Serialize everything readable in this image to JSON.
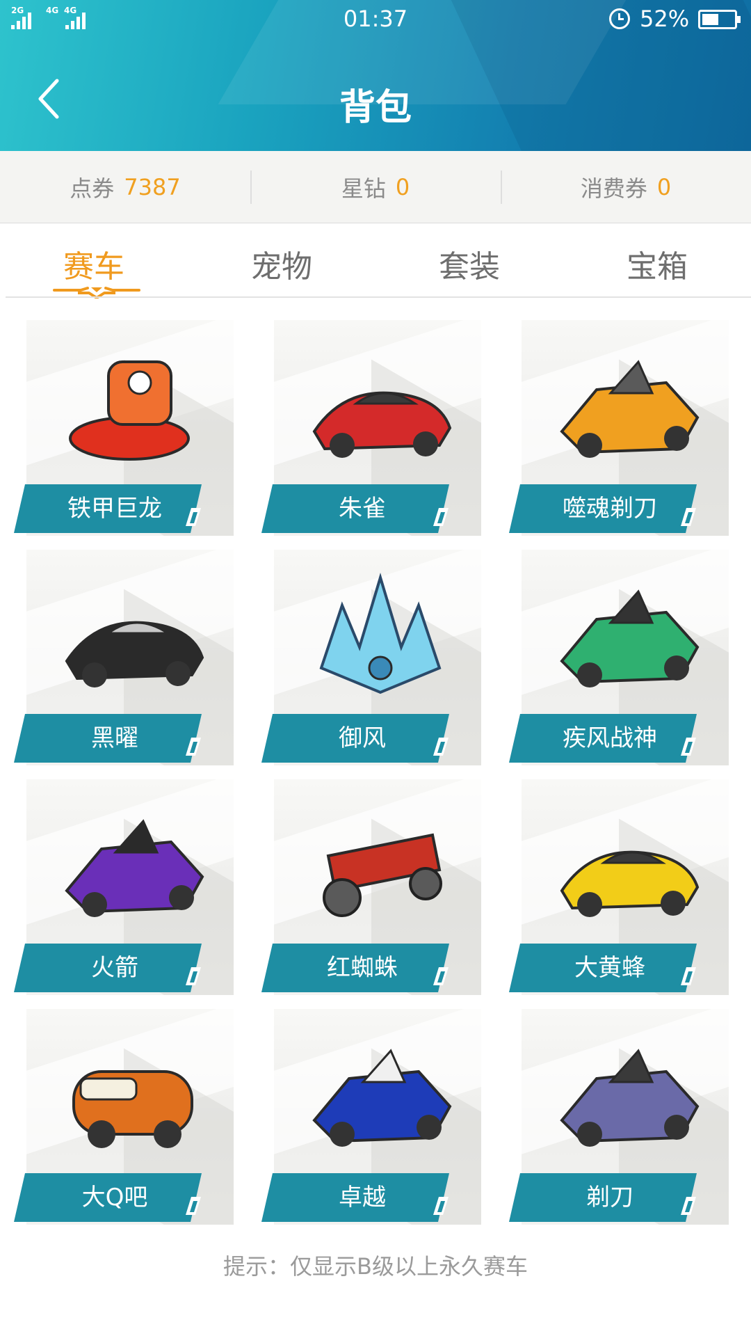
{
  "status_bar": {
    "signal_1": "2G",
    "signal_2": "4G",
    "signal_3": "4G",
    "time": "01:37",
    "battery": "52%",
    "battery_fraction": 0.52
  },
  "header": {
    "title": "背包"
  },
  "currency": [
    {
      "label": "点券",
      "value": "7387"
    },
    {
      "label": "星钻",
      "value": "0"
    },
    {
      "label": "消费券",
      "value": "0"
    }
  ],
  "tabs": [
    {
      "label": "赛车",
      "active": true
    },
    {
      "label": "宠物",
      "active": false
    },
    {
      "label": "套装",
      "active": false
    },
    {
      "label": "宝箱",
      "active": false
    }
  ],
  "cars": [
    {
      "name": "铁甲巨龙",
      "color": "#e0301e",
      "accent": "#f07030"
    },
    {
      "name": "朱雀",
      "color": "#d42a2a",
      "accent": "#3a3a3a"
    },
    {
      "name": "噬魂剃刀",
      "color": "#f0a020",
      "accent": "#5a5a5a"
    },
    {
      "name": "黑曜",
      "color": "#2a2a2a",
      "accent": "#c8c8c8"
    },
    {
      "name": "御风",
      "color": "#7fd3ee",
      "accent": "#3a8ab8"
    },
    {
      "name": "疾风战神",
      "color": "#2fb070",
      "accent": "#333333"
    },
    {
      "name": "火箭",
      "color": "#6a2fb8",
      "accent": "#2a2a2a"
    },
    {
      "name": "红蜘蛛",
      "color": "#c83224",
      "accent": "#5a5a5a"
    },
    {
      "name": "大黄蜂",
      "color": "#f2cd18",
      "accent": "#3a3a3a"
    },
    {
      "name": "大Q吧",
      "color": "#e0701e",
      "accent": "#f5f0e0"
    },
    {
      "name": "卓越",
      "color": "#1e3cb8",
      "accent": "#f0f0f0"
    },
    {
      "name": "剃刀",
      "color": "#6a6aa8",
      "accent": "#3a3a3a"
    }
  ],
  "hint": "提示：仅显示B级以上永久赛车",
  "colors": {
    "ribbon": "#1e8ea3",
    "highlight": "#f09a1e",
    "header": "#1a9cbc"
  }
}
